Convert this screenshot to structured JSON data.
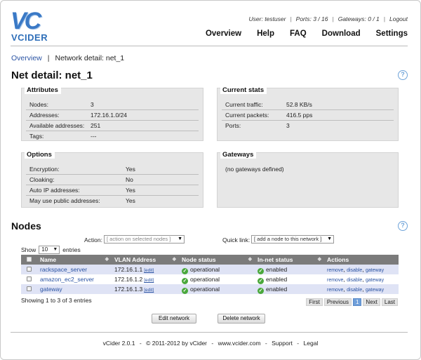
{
  "logo": {
    "mark": "VC",
    "wordmark": "VCIDER"
  },
  "userbar": {
    "user": "User: testuser",
    "ports": "Ports: 3 / 16",
    "gateways": "Gateways: 0 / 1",
    "logout": "Logout",
    "sep": "|"
  },
  "nav": [
    "Overview",
    "Help",
    "FAQ",
    "Download",
    "Settings"
  ],
  "breadcrumb": {
    "home": "Overview",
    "sep": "|",
    "current": "Network detail: net_1"
  },
  "title": "Net detail: net_1",
  "help_icon": "?",
  "attributes": {
    "title": "Attributes",
    "rows": [
      {
        "k": "Nodes:",
        "v": "3"
      },
      {
        "k": "Addresses:",
        "v": "172.16.1.0/24"
      },
      {
        "k": "Available addresses:",
        "v": "251"
      },
      {
        "k": "Tags:",
        "v": "---"
      }
    ]
  },
  "stats": {
    "title": "Current stats",
    "rows": [
      {
        "k": "Current traffic:",
        "v": "52.8 KB/s"
      },
      {
        "k": "Current packets:",
        "v": "416.5 pps"
      },
      {
        "k": "Ports:",
        "v": "3"
      }
    ]
  },
  "options": {
    "title": "Options",
    "rows": [
      {
        "k": "Encryption:",
        "v": "Yes"
      },
      {
        "k": "Cloaking:",
        "v": "No"
      },
      {
        "k": "Auto IP addresses:",
        "v": "Yes"
      },
      {
        "k": "May use public addresses:",
        "v": "Yes"
      }
    ]
  },
  "gateways": {
    "title": "Gateways",
    "empty": "(no gateways defined)"
  },
  "nodes": {
    "title": "Nodes",
    "action_label": "Action:",
    "action_select": "[ action on selected nodes ]",
    "quicklink_label": "Quick link:",
    "quicklink_select": "[ add a node to this network ]",
    "show_label": "Show",
    "show_value": "10",
    "entries_label": "entries",
    "columns": [
      "Name",
      "VLAN Address",
      "Node status",
      "In-net status",
      "Actions"
    ],
    "rows": [
      {
        "name": "rackspace_server",
        "vlan": "172.16.1.1",
        "edit": "[edit]",
        "status": "operational",
        "innet": "enabled",
        "a1": "remove",
        "a2": "disable",
        "a3": "gateway"
      },
      {
        "name": "amazon_ec2_server",
        "vlan": "172.16.1.2",
        "edit": "[edit]",
        "status": "operational",
        "innet": "enabled",
        "a1": "remove",
        "a2": "disable",
        "a3": "gateway"
      },
      {
        "name": "gateway",
        "vlan": "172.16.1.3",
        "edit": "[edit]",
        "status": "operational",
        "innet": "enabled",
        "a1": "remove",
        "a2": "disable",
        "a3": "gateway"
      }
    ],
    "showing": "Showing 1 to 3 of 3 entries",
    "pager": {
      "first": "First",
      "previous": "Previous",
      "page": "1",
      "next": "Next",
      "last": "Last"
    },
    "edit_button": "Edit network",
    "delete_button": "Delete network"
  },
  "footer": {
    "version": "vCider 2.0.1",
    "copyright": "© 2011-2012 by vCider",
    "site": "www.vcider.com",
    "support": "Support",
    "legal": "Legal",
    "dash": "-"
  }
}
